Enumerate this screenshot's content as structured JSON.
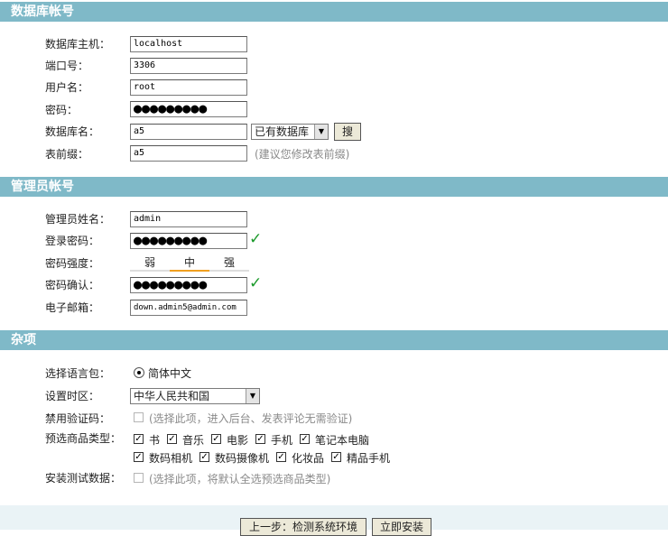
{
  "sections": {
    "db": "数据库帐号",
    "admin": "管理员帐号",
    "misc": "杂项"
  },
  "db": {
    "host_label": "数据库主机：",
    "host_value": "localhost",
    "port_label": "端口号：",
    "port_value": "3306",
    "user_label": "用户名：",
    "user_value": "root",
    "pass_label": "密码：",
    "pass_value": "●●●●●●●●●",
    "name_label": "数据库名：",
    "name_value": "a5",
    "existing_db_select": "已有数据库",
    "search_button": "搜",
    "prefix_label": "表前缀：",
    "prefix_value": "a5",
    "prefix_hint": "(建议您修改表前缀)"
  },
  "admin": {
    "name_label": "管理员姓名：",
    "name_value": "admin",
    "pass_label": "登录密码：",
    "pass_value": "●●●●●●●●●",
    "strength_label": "密码强度：",
    "strength_levels": [
      "弱",
      "中",
      "强"
    ],
    "strength_level": "中",
    "confirm_label": "密码确认：",
    "confirm_value": "●●●●●●●●●",
    "email_label": "电子邮箱：",
    "email_value": "down.admin5@admin.com",
    "check_glyph": "✓"
  },
  "misc": {
    "lang_label": "选择语言包：",
    "lang_option": "简体中文",
    "tz_label": "设置时区：",
    "tz_value": "中华人民共和国",
    "captcha_label": "禁用验证码：",
    "captcha_hint": "(选择此项，进入后台、发表评论无需验证)",
    "goods_label": "预选商品类型：",
    "goods_row1": [
      "书",
      "音乐",
      "电影",
      "手机",
      "笔记本电脑"
    ],
    "goods_row2": [
      "数码相机",
      "数码摄像机",
      "化妆品",
      "精品手机"
    ],
    "test_label": "安装测试数据：",
    "test_hint": "(选择此项，将默认全选预选商品类型)"
  },
  "footer": {
    "prev_button": "上一步：检测系统环境",
    "install_button": "立即安装"
  }
}
